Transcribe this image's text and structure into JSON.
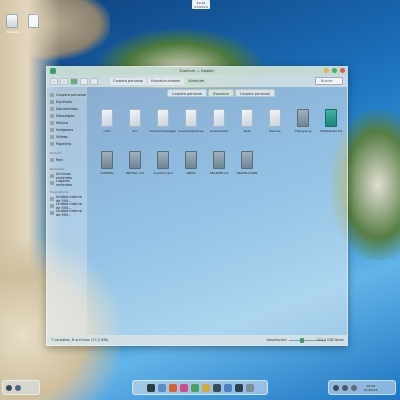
{
  "desktop": {
    "trash_label": "Papelera",
    "top_clock": {
      "time": "10:26",
      "date": "07/02/24"
    }
  },
  "window": {
    "title": "Kvantum — Dolphin",
    "toolbar": {
      "back": "‹",
      "forward": "›",
      "breadcrumbs": [
        "Carpeta personal",
        "Kvantum-master",
        "Kvantum"
      ],
      "search": "Buscar"
    },
    "tabs": [
      "Carpeta personal",
      "Kvantum",
      "Carpeta personal"
    ],
    "sidebar": {
      "places_items": [
        {
          "label": "Carpeta personal",
          "icon": "home-icon"
        },
        {
          "label": "Escritorio",
          "icon": "desktop-icon"
        },
        {
          "label": "Documentos",
          "icon": "documents-icon"
        },
        {
          "label": "Descargas",
          "icon": "downloads-icon"
        },
        {
          "label": "Música",
          "icon": "music-icon"
        },
        {
          "label": "Imágenes",
          "icon": "pictures-icon"
        },
        {
          "label": "Vídeos",
          "icon": "videos-icon"
        },
        {
          "label": "Papelera",
          "icon": "trash-icon"
        }
      ],
      "remote_label": "Remoto",
      "remote_items": [
        {
          "label": "Red",
          "icon": "network-icon"
        }
      ],
      "recent_label": "Recientes",
      "recent_items": [
        {
          "label": "Archivos recientes",
          "icon": "recent-files-icon"
        },
        {
          "label": "Lugares recientes",
          "icon": "recent-places-icon"
        }
      ],
      "devices_label": "Dispositivos",
      "devices_items": [
        {
          "label": "Unidad interna de 500...",
          "icon": "drive-icon"
        },
        {
          "label": "Unidad interna de 500...",
          "icon": "drive-icon"
        },
        {
          "label": "Unidad interna de 500...",
          "icon": "drive-icon"
        }
      ]
    },
    "items": [
      {
        "name": "color",
        "type": "folder"
      },
      {
        "name": "doc",
        "type": "folder"
      },
      {
        "name": "kvantummanager",
        "type": "folder"
      },
      {
        "name": "kvantumpreview",
        "type": "folder"
      },
      {
        "name": "screenshots",
        "type": "folder"
      },
      {
        "name": "style",
        "type": "folder"
      },
      {
        "name": "themes",
        "type": "folder"
      },
      {
        "name": "ChangeLog",
        "type": "file"
      },
      {
        "name": "CMakeLists.txt",
        "type": "file-teal"
      },
      {
        "name": "COPYING",
        "type": "file"
      },
      {
        "name": "INSTALL.md",
        "type": "file"
      },
      {
        "name": "kvantum.pro",
        "type": "file"
      },
      {
        "name": "NEWS",
        "type": "file"
      },
      {
        "name": "README.md",
        "type": "file"
      },
      {
        "name": "TRANSLATION",
        "type": "file"
      }
    ],
    "status": {
      "summary": "7 carpetas, 8 archivos (17,2 KiB)",
      "zoom_label": "Ampliación:",
      "zoom_level": 0.3,
      "free_space": "133,4 GiB libres"
    }
  },
  "dock": {
    "items": [
      {
        "icon": "launcher-icon",
        "color": "#2f3b47"
      },
      {
        "icon": "files-icon",
        "color": "#5b8fc8"
      },
      {
        "icon": "browser-icon",
        "color": "#e25d2c"
      },
      {
        "icon": "store-icon",
        "color": "#d64a8a"
      },
      {
        "icon": "terminal-icon",
        "color": "#4da05d"
      },
      {
        "icon": "settings-icon",
        "color": "#d9a937"
      },
      {
        "icon": "music-player-icon",
        "color": "#3a4b5a"
      },
      {
        "icon": "editor-icon",
        "color": "#4d7fc2"
      },
      {
        "icon": "image-viewer-icon",
        "color": "#2d3e50"
      },
      {
        "icon": "trash-dock-icon",
        "color": "#7f8c96"
      }
    ]
  },
  "tray": {
    "clock_time": "10:26",
    "clock_date": "07/02/24"
  }
}
